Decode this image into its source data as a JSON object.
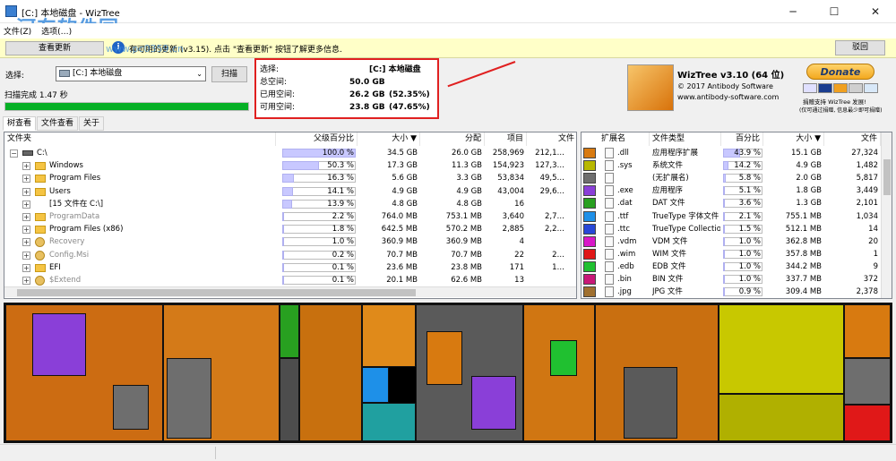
{
  "window": {
    "title": "[C:] 本地磁盘 - WizTree",
    "minimize": "─",
    "maximize": "☐",
    "close": "✕"
  },
  "menu": [
    "文件(Z)",
    "选项(…)"
  ],
  "update": {
    "button": "查看更新",
    "message": "有可用的更新 (v3.15). 点击 \"查看更新\" 按钮了解更多信息.",
    "close_button": "驳回"
  },
  "watermark": {
    "brand": "河东软件园",
    "url": "www.pc0359.cn"
  },
  "scan": {
    "select_label": "选择:",
    "drive": "[C:] 本地磁盘",
    "scan_button": "扫描",
    "status": "扫描完成 1.47 秒",
    "progress": 1.0
  },
  "stats": {
    "select": {
      "label": "选择:",
      "value": "[C:]  本地磁盘"
    },
    "total": {
      "label": "总空间:",
      "value": "50.0 GB"
    },
    "used": {
      "label": "已用空间:",
      "value": "26.2 GB",
      "pct": "(52.35%)"
    },
    "free": {
      "label": "可用空间:",
      "value": "23.8 GB",
      "pct": "(47.65%)"
    }
  },
  "about": {
    "name": "WizTree v3.10 (64 位)",
    "copyright": "© 2017 Antibody Software",
    "site": "www.antibody-software.com",
    "donate": "Donate",
    "note1": "捐赠支持 WizTree 发展!",
    "note2": "(仅可通过捐赠, 信息最少即可捐赠)"
  },
  "tabs": [
    "树查看",
    "文件查看",
    "关于"
  ],
  "tree": {
    "columns": [
      "文件夹",
      "父级百分比",
      "大小 ▼",
      "分配",
      "项目",
      "文件"
    ],
    "rows": [
      {
        "indent": 0,
        "icon": "drive",
        "name": "C:\\",
        "pct": "100.0 %",
        "pctv": 1.0,
        "size": "34.5 GB",
        "alloc": "26.0 GB",
        "items": "258,969",
        "files": "212,1…",
        "dim": false
      },
      {
        "indent": 1,
        "icon": "folder",
        "name": "Windows",
        "pct": "50.3 %",
        "pctv": 0.503,
        "size": "17.3 GB",
        "alloc": "11.3 GB",
        "items": "154,923",
        "files": "127,3…",
        "dim": false
      },
      {
        "indent": 1,
        "icon": "folder",
        "name": "Program Files",
        "pct": "16.3 %",
        "pctv": 0.163,
        "size": "5.6 GB",
        "alloc": "3.3 GB",
        "items": "53,834",
        "files": "49,5…",
        "dim": false
      },
      {
        "indent": 1,
        "icon": "folder",
        "name": "Users",
        "pct": "14.1 %",
        "pctv": 0.141,
        "size": "4.9 GB",
        "alloc": "4.9 GB",
        "items": "43,004",
        "files": "29,6…",
        "dim": false
      },
      {
        "indent": 1,
        "icon": "none",
        "name": "[15 文件在 C:\\]",
        "pct": "13.9 %",
        "pctv": 0.139,
        "size": "4.8 GB",
        "alloc": "4.8 GB",
        "items": "16",
        "files": "",
        "dim": false
      },
      {
        "indent": 1,
        "icon": "folder",
        "name": "ProgramData",
        "pct": "2.2 %",
        "pctv": 0.022,
        "size": "764.0 MB",
        "alloc": "753.1 MB",
        "items": "3,640",
        "files": "2,7…",
        "dim": true
      },
      {
        "indent": 1,
        "icon": "folder",
        "name": "Program Files (x86)",
        "pct": "1.8 %",
        "pctv": 0.018,
        "size": "642.5 MB",
        "alloc": "570.2 MB",
        "items": "2,885",
        "files": "2,2…",
        "dim": false
      },
      {
        "indent": 1,
        "icon": "gear",
        "name": "Recovery",
        "pct": "1.0 %",
        "pctv": 0.01,
        "size": "360.9 MB",
        "alloc": "360.9 MB",
        "items": "4",
        "files": "",
        "dim": true
      },
      {
        "indent": 1,
        "icon": "gear",
        "name": "Config.Msi",
        "pct": "0.2 %",
        "pctv": 0.002,
        "size": "70.7 MB",
        "alloc": "70.7 MB",
        "items": "22",
        "files": "2…",
        "dim": true
      },
      {
        "indent": 1,
        "icon": "folder",
        "name": "EFI",
        "pct": "0.1 %",
        "pctv": 0.001,
        "size": "23.6 MB",
        "alloc": "23.8 MB",
        "items": "171",
        "files": "1…",
        "dim": false
      },
      {
        "indent": 1,
        "icon": "gear",
        "name": "$Extend",
        "pct": "0.1 %",
        "pctv": 0.001,
        "size": "20.1 MB",
        "alloc": "62.6 MB",
        "items": "13",
        "files": "",
        "dim": true
      }
    ]
  },
  "ext": {
    "columns": [
      "扩展名",
      "文件类型",
      "百分比",
      "大小 ▼",
      "文件"
    ],
    "rows": [
      {
        "color": "#d87a10",
        "ext": ".dll",
        "type": "应用程序扩展",
        "pct": "43.9 %",
        "pctv": 0.439,
        "size": "15.1 GB",
        "files": "27,324"
      },
      {
        "color": "#b8b800",
        "ext": ".sys",
        "type": "系统文件",
        "pct": "14.2 %",
        "pctv": 0.142,
        "size": "4.9 GB",
        "files": "1,482"
      },
      {
        "color": "#6e6e6e",
        "ext": "",
        "type": "(无扩展名)",
        "pct": "5.8 %",
        "pctv": 0.058,
        "size": "2.0 GB",
        "files": "5,817"
      },
      {
        "color": "#8a3fd8",
        "ext": ".exe",
        "type": "应用程序",
        "pct": "5.1 %",
        "pctv": 0.051,
        "size": "1.8 GB",
        "files": "3,449"
      },
      {
        "color": "#28a020",
        "ext": ".dat",
        "type": "DAT 文件",
        "pct": "3.6 %",
        "pctv": 0.036,
        "size": "1.3 GB",
        "files": "2,101"
      },
      {
        "color": "#1e90e8",
        "ext": ".ttf",
        "type": "TrueType 字体文件",
        "pct": "2.1 %",
        "pctv": 0.021,
        "size": "755.1 MB",
        "files": "1,034"
      },
      {
        "color": "#2848d8",
        "ext": ".ttc",
        "type": "TrueType Collectio…",
        "pct": "1.5 %",
        "pctv": 0.015,
        "size": "512.1 MB",
        "files": "14"
      },
      {
        "color": "#d818c8",
        "ext": ".vdm",
        "type": "VDM 文件",
        "pct": "1.0 %",
        "pctv": 0.01,
        "size": "362.8 MB",
        "files": "20"
      },
      {
        "color": "#e01818",
        "ext": ".wim",
        "type": "WIM 文件",
        "pct": "1.0 %",
        "pctv": 0.01,
        "size": "357.8 MB",
        "files": "1"
      },
      {
        "color": "#20c030",
        "ext": ".edb",
        "type": "EDB 文件",
        "pct": "1.0 %",
        "pctv": 0.01,
        "size": "344.2 MB",
        "files": "9"
      },
      {
        "color": "#c81878",
        "ext": ".bin",
        "type": "BIN 文件",
        "pct": "1.0 %",
        "pctv": 0.01,
        "size": "337.7 MB",
        "files": "372"
      },
      {
        "color": "#a07030",
        "ext": ".jpg",
        "type": "JPG 文件",
        "pct": "0.9 %",
        "pctv": 0.009,
        "size": "309.4 MB",
        "files": "2,378"
      }
    ]
  },
  "colors": {
    "accent": "#e02020",
    "progress": "#06b025",
    "treemap_main": "#d87a10",
    "treemap_sys": "#c8c800"
  }
}
